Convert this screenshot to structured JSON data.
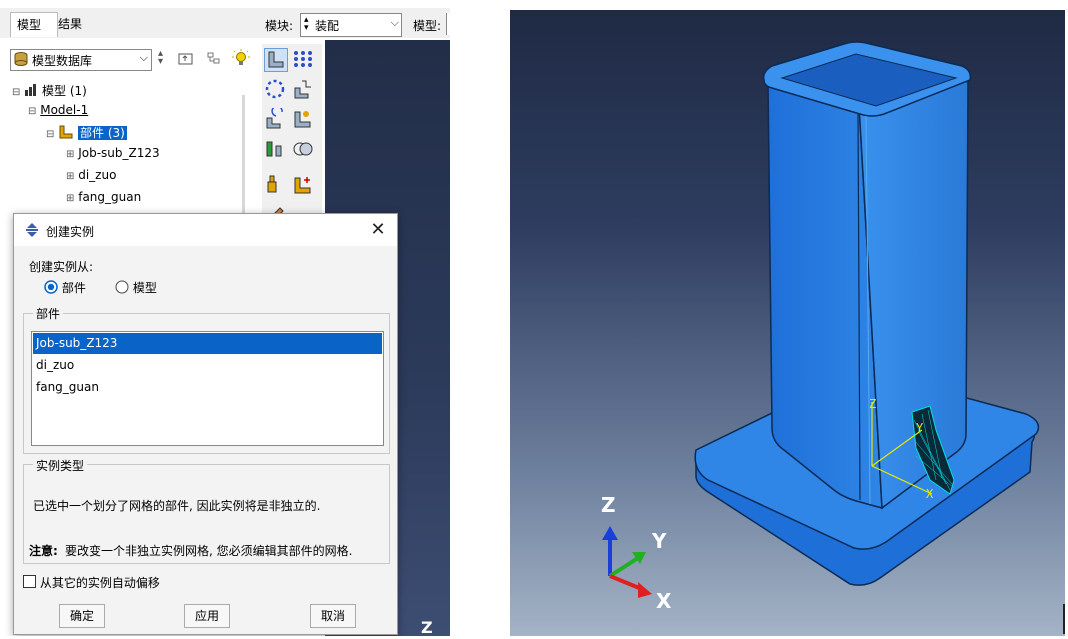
{
  "tabs": {
    "model": "模型",
    "results": "结果"
  },
  "toolbar": {
    "module_label": "模块:",
    "module_value": "装配",
    "model_label": "模型:"
  },
  "tree": {
    "db_select": "模型数据库",
    "root": "模型 (1)",
    "model": "Model-1",
    "parts_node": "部件 (3)",
    "parts": [
      "Job-sub_Z123",
      "di_zuo",
      "fang_guan"
    ]
  },
  "dialog": {
    "title": "创建实例",
    "from_label": "创建实例从:",
    "radio_part": "部件",
    "radio_model": "模型",
    "parts_group": "部件",
    "parts": [
      "Job-sub_Z123",
      "di_zuo",
      "fang_guan"
    ],
    "selected_index": 0,
    "instance_type_group": "实例类型",
    "info": "已选中一个划分了网格的部件, 因此实例将是非独立的.",
    "note_prefix": "注意:",
    "note": "要改变一个非独立实例网格, 您必须编辑其部件的网格.",
    "auto_offset": "从其它的实例自动偏移",
    "ok": "确定",
    "apply": "应用",
    "cancel": "取消"
  },
  "viewport_left": {
    "axis_z": "Z"
  },
  "viewport_right": {
    "triad": {
      "x": "X",
      "y": "Y",
      "z": "Z"
    },
    "part_axes": {
      "x": "X",
      "y": "Y",
      "z": "Z"
    }
  },
  "colors": {
    "part_blue": "#2b78d6",
    "selection": "#0a64c8",
    "viewport_top": "#1f2a44",
    "viewport_bottom": "#a4b3c6"
  }
}
